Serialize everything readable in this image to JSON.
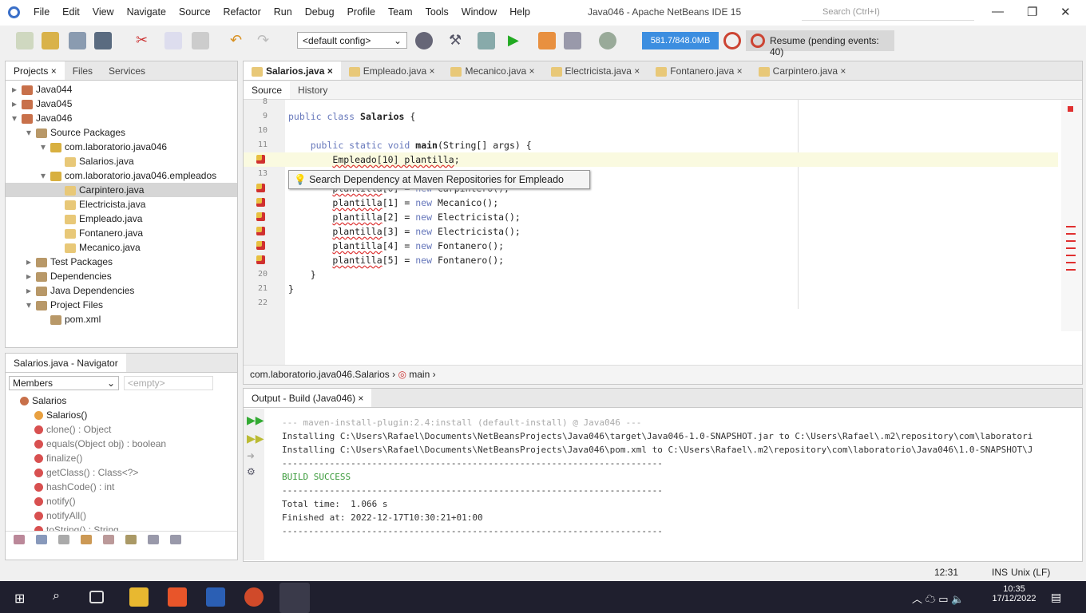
{
  "window": {
    "title": "Java046 - Apache NetBeans IDE 15",
    "search_placeholder": "Search (Ctrl+I)"
  },
  "menu": [
    "File",
    "Edit",
    "View",
    "Navigate",
    "Source",
    "Refactor",
    "Run",
    "Debug",
    "Profile",
    "Team",
    "Tools",
    "Window",
    "Help"
  ],
  "toolbar": {
    "config": "<default config>",
    "memory": "581.7/848.0MB",
    "resume": "Resume (pending events: 40)"
  },
  "projects": {
    "tabs": [
      "Projects",
      "Files",
      "Services"
    ],
    "tree": [
      {
        "label": "Java044",
        "level": 0,
        "exp": "▸"
      },
      {
        "label": "Java045",
        "level": 0,
        "exp": "▸"
      },
      {
        "label": "Java046",
        "level": 0,
        "exp": "▾"
      },
      {
        "label": "Source Packages",
        "level": 1,
        "exp": "▾"
      },
      {
        "label": "com.laboratorio.java046",
        "level": 2,
        "exp": "▾"
      },
      {
        "label": "Salarios.java",
        "level": 3,
        "exp": ""
      },
      {
        "label": "com.laboratorio.java046.empleados",
        "level": 2,
        "exp": "▾"
      },
      {
        "label": "Carpintero.java",
        "level": 3,
        "exp": "",
        "sel": true
      },
      {
        "label": "Electricista.java",
        "level": 3,
        "exp": ""
      },
      {
        "label": "Empleado.java",
        "level": 3,
        "exp": ""
      },
      {
        "label": "Fontanero.java",
        "level": 3,
        "exp": ""
      },
      {
        "label": "Mecanico.java",
        "level": 3,
        "exp": ""
      },
      {
        "label": "Test Packages",
        "level": 1,
        "exp": "▸"
      },
      {
        "label": "Dependencies",
        "level": 1,
        "exp": "▸"
      },
      {
        "label": "Java Dependencies",
        "level": 1,
        "exp": "▸"
      },
      {
        "label": "Project Files",
        "level": 1,
        "exp": "▾"
      },
      {
        "label": "pom.xml",
        "level": 2,
        "exp": ""
      }
    ]
  },
  "navigator": {
    "title": "Salarios.java - Navigator",
    "filter": "Members",
    "empty": "<empty>",
    "items": [
      "Salarios",
      "Salarios()",
      "clone() : Object",
      "equals(Object obj) : boolean",
      "finalize()",
      "getClass() : Class<?>",
      "hashCode() : int",
      "notify()",
      "notifyAll()",
      "toString() : String"
    ]
  },
  "editor": {
    "tabs": [
      "Salarios.java",
      "Empleado.java",
      "Mecanico.java",
      "Electricista.java",
      "Fontanero.java",
      "Carpintero.java"
    ],
    "subtabs": [
      "Source",
      "History"
    ],
    "lines": [
      {
        "n": "8",
        "html": ""
      },
      {
        "n": "9",
        "html": "<span class='kw'>public class</span> <span class='b'>Salarios</span> {"
      },
      {
        "n": "10",
        "html": ""
      },
      {
        "n": "11",
        "html": "    <span class='kw'>public static void</span> <span class='b'>main</span>(String[] args) {"
      },
      {
        "n": "",
        "html": "        <span class='err'>Empleado[10] plantilla</span>;"
      },
      {
        "n": "13",
        "html": ""
      },
      {
        "n": "",
        "html": "        <span class='err'>plantilla</span>[0] = <span class='kw'>new</span> Carpintero();"
      },
      {
        "n": "",
        "html": "        <span class='err'>plantilla</span>[1] = <span class='kw'>new</span> Mecanico();"
      },
      {
        "n": "",
        "html": "        <span class='err'>plantilla</span>[2] = <span class='kw'>new</span> Electricista();"
      },
      {
        "n": "",
        "html": "        <span class='err'>plantilla</span>[3] = <span class='kw'>new</span> Electricista();"
      },
      {
        "n": "",
        "html": "        <span class='err'>plantilla</span>[4] = <span class='kw'>new</span> Fontanero();"
      },
      {
        "n": "",
        "html": "        <span class='err'>plantilla</span>[5] = <span class='kw'>new</span> Fontanero();"
      },
      {
        "n": "20",
        "html": "    }"
      },
      {
        "n": "21",
        "html": "}"
      },
      {
        "n": "22",
        "html": ""
      }
    ],
    "hint": "Search Dependency at Maven Repositories for Empleado",
    "breadcrumb": [
      "com.laboratorio.java046.Salarios",
      "main"
    ]
  },
  "output": {
    "title": "Output - Build (Java046)",
    "lines": [
      "--- maven-install-plugin:2.4:install (default-install) @ Java046 ---",
      "Installing C:\\Users\\Rafael\\Documents\\NetBeansProjects\\Java046\\target\\Java046-1.0-SNAPSHOT.jar to C:\\Users\\Rafael\\.m2\\repository\\com\\laboratori",
      "Installing C:\\Users\\Rafael\\Documents\\NetBeansProjects\\Java046\\pom.xml to C:\\Users\\Rafael\\.m2\\repository\\com\\laboratorio\\Java046\\1.0-SNAPSHOT\\J",
      "------------------------------------------------------------------------",
      "BUILD SUCCESS",
      "------------------------------------------------------------------------",
      "Total time:  1.066 s",
      "Finished at: 2022-12-17T10:30:21+01:00",
      "------------------------------------------------------------------------"
    ]
  },
  "status": {
    "position": "12:31",
    "mode": "INS",
    "eol": "Unix (LF)"
  },
  "taskbar": {
    "time": "10:35",
    "date": "17/12/2022"
  }
}
